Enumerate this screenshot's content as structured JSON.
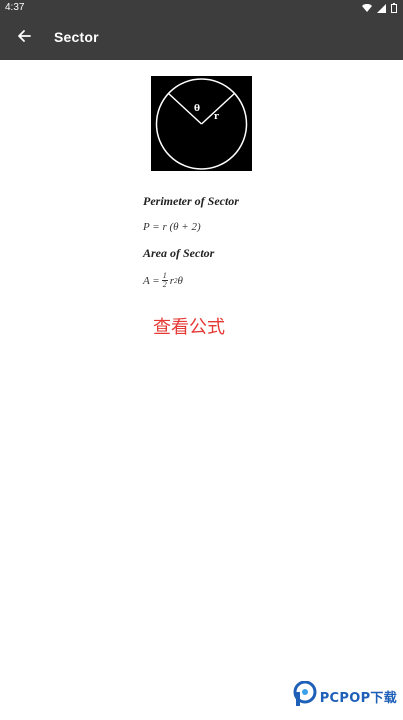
{
  "status_bar": {
    "time": "4:37",
    "icons": [
      "wifi-icon",
      "cellular-signal-icon",
      "battery-icon"
    ]
  },
  "app_bar": {
    "back_icon": "arrow-left-icon",
    "title": "Sector"
  },
  "figure": {
    "theta_label": "θ",
    "radius_label": "r",
    "background_color": "#000000",
    "stroke_color": "#ffffff"
  },
  "formulas": {
    "perimeter_heading": "Perimeter of Sector",
    "perimeter_formula": "P = r (θ + 2)",
    "area_heading": "Area of Sector",
    "area_formula_lhs": "A =",
    "area_fraction_numerator": "1",
    "area_fraction_denominator": "2",
    "area_formula_var": "r",
    "area_formula_exponent": "2",
    "area_formula_theta": "θ"
  },
  "actions": {
    "view_formula_label": "查看公式",
    "view_formula_color": "#e53935"
  },
  "watermark": {
    "text": "PCPOP下载",
    "color": "#1e5fb8"
  }
}
